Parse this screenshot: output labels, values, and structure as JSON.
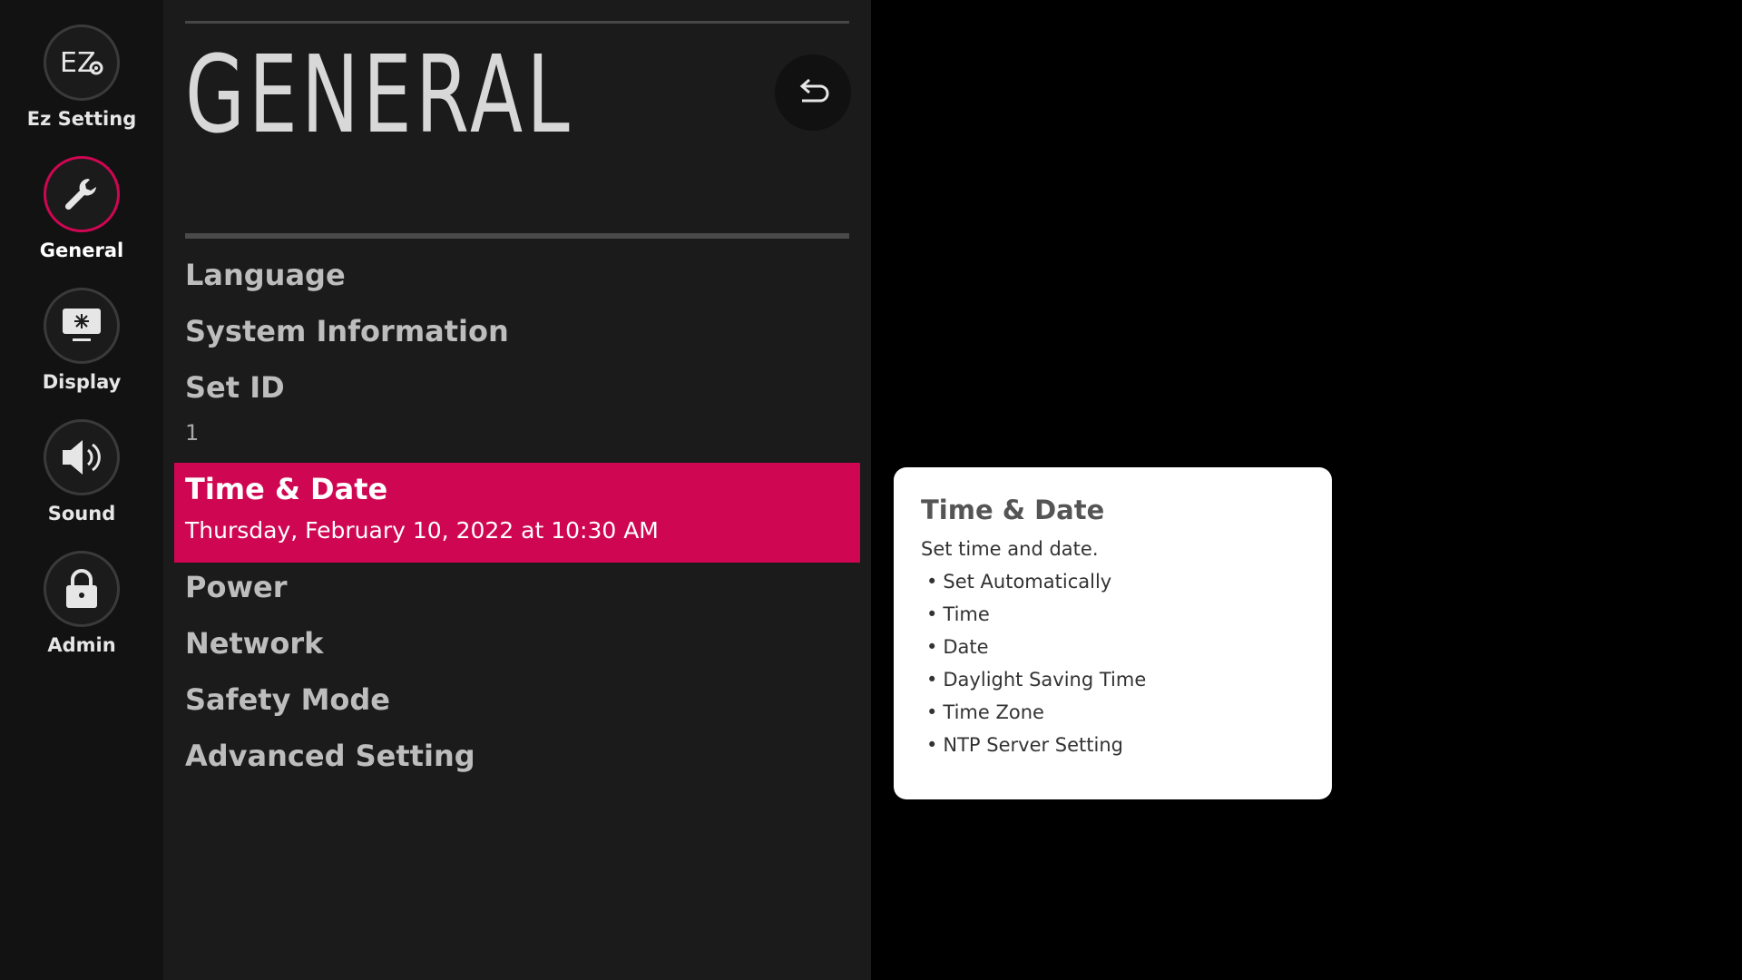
{
  "sidebar": {
    "items": [
      {
        "label": "Ez Setting",
        "icon": "ez-setting-icon"
      },
      {
        "label": "General",
        "icon": "wrench-icon",
        "active": true
      },
      {
        "label": "Display",
        "icon": "display-icon"
      },
      {
        "label": "Sound",
        "icon": "speaker-icon"
      },
      {
        "label": "Admin",
        "icon": "lock-icon"
      }
    ],
    "ez_icon_text": "EZ"
  },
  "header": {
    "title": "GENERAL",
    "back_icon": "back-arrow-icon"
  },
  "menu": {
    "items": [
      {
        "label": "Language"
      },
      {
        "label": "System Information"
      },
      {
        "label": "Set ID",
        "value": "1"
      },
      {
        "label": "Time & Date",
        "value": "Thursday, February 10, 2022 at 10:30 AM",
        "selected": true
      },
      {
        "label": "Power"
      },
      {
        "label": "Network"
      },
      {
        "label": "Safety Mode"
      },
      {
        "label": "Advanced Setting"
      }
    ]
  },
  "info": {
    "title": "Time & Date",
    "description": "Set time and date.",
    "bullet": "•",
    "items": [
      "Set Automatically",
      "Time",
      "Date",
      "Daylight Saving Time",
      "Time Zone",
      "NTP Server Setting"
    ]
  },
  "colors": {
    "accent": "#cf0652",
    "panel": "#1b1b1b",
    "rail": "#121212",
    "background": "#000000"
  }
}
